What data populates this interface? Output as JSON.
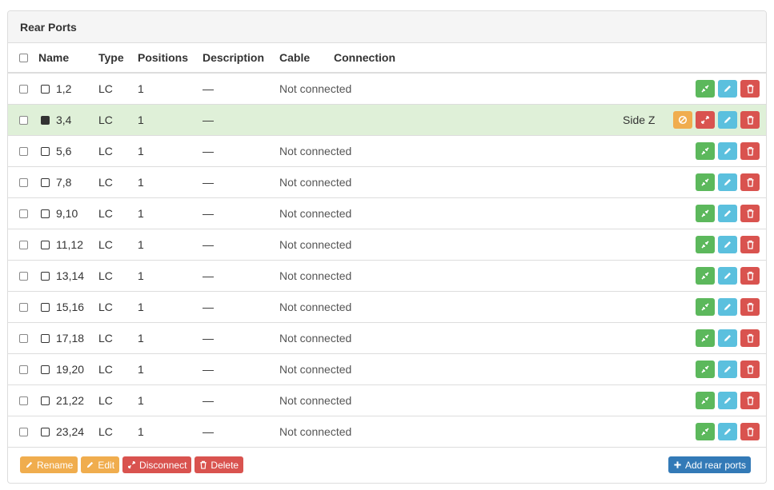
{
  "panel": {
    "title": "Rear Ports"
  },
  "columns": {
    "name": "Name",
    "type": "Type",
    "positions": "Positions",
    "description": "Description",
    "cable": "Cable",
    "connection": "Connection"
  },
  "rows": [
    {
      "name": "1,2",
      "type": "LC",
      "positions": "1",
      "description": "—",
      "status": "Not connected"
    },
    {
      "name": "3,4",
      "type": "LC",
      "positions": "1",
      "description": "—",
      "status": "",
      "side": "Side Z"
    },
    {
      "name": "5,6",
      "type": "LC",
      "positions": "1",
      "description": "—",
      "status": "Not connected"
    },
    {
      "name": "7,8",
      "type": "LC",
      "positions": "1",
      "description": "—",
      "status": "Not connected"
    },
    {
      "name": "9,10",
      "type": "LC",
      "positions": "1",
      "description": "—",
      "status": "Not connected"
    },
    {
      "name": "11,12",
      "type": "LC",
      "positions": "1",
      "description": "—",
      "status": "Not connected"
    },
    {
      "name": "13,14",
      "type": "LC",
      "positions": "1",
      "description": "—",
      "status": "Not connected"
    },
    {
      "name": "15,16",
      "type": "LC",
      "positions": "1",
      "description": "—",
      "status": "Not connected"
    },
    {
      "name": "17,18",
      "type": "LC",
      "positions": "1",
      "description": "—",
      "status": "Not connected"
    },
    {
      "name": "19,20",
      "type": "LC",
      "positions": "1",
      "description": "—",
      "status": "Not connected"
    },
    {
      "name": "21,22",
      "type": "LC",
      "positions": "1",
      "description": "—",
      "status": "Not connected"
    },
    {
      "name": "23,24",
      "type": "LC",
      "positions": "1",
      "description": "—",
      "status": "Not connected"
    }
  ],
  "footer": {
    "rename": "Rename",
    "edit": "Edit",
    "disconnect": "Disconnect",
    "delete": "Delete",
    "add": "Add rear ports"
  },
  "icons": {
    "connect": "connect-icon",
    "edit": "pencil-icon",
    "delete": "trash-icon",
    "disconnect": "disconnect-icon",
    "block": "ban-icon",
    "port": "port-icon",
    "add": "plus-icon"
  },
  "colors": {
    "green": "#5cb85c",
    "blue": "#5bc0de",
    "red": "#d9534f",
    "orange": "#f0ad4e",
    "primary": "#337ab7",
    "connected_row": "#dff0d8"
  }
}
